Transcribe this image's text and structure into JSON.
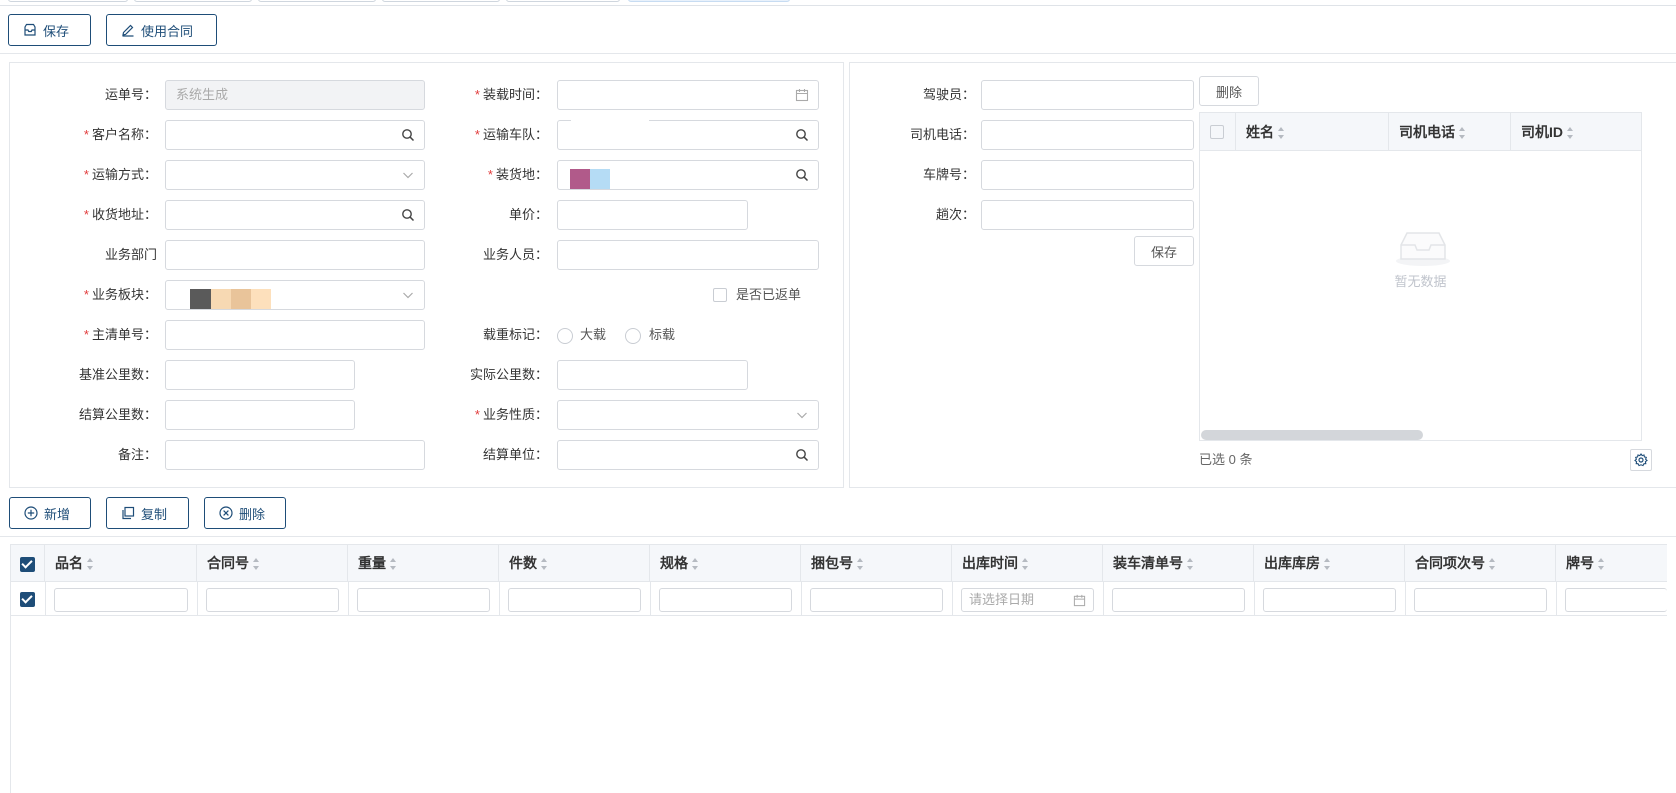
{
  "toolbar": {
    "save_label": "保存",
    "use_contract_label": "使用合同"
  },
  "form": {
    "waybill_no": {
      "label": "运单号：",
      "placeholder": "系统生成"
    },
    "customer_name": {
      "label": "客户名称："
    },
    "transport_mode": {
      "label": "运输方式："
    },
    "receive_address": {
      "label": "收货地址："
    },
    "business_dept": {
      "label": "业务部门"
    },
    "business_segment": {
      "label": "业务板块："
    },
    "master_order_no": {
      "label": "主清单号："
    },
    "base_km": {
      "label": "基准公里数："
    },
    "settle_km": {
      "label": "结算公里数："
    },
    "remark": {
      "label": "备注："
    },
    "load_time": {
      "label": "装载时间："
    },
    "transport_fleet": {
      "label": "运输车队："
    },
    "load_place": {
      "label": "装货地："
    },
    "unit_price": {
      "label": "单价："
    },
    "salesperson": {
      "label": "业务人员："
    },
    "returned": {
      "label": "是否已返单"
    },
    "load_mark": {
      "label": "载重标记：",
      "option_big": "大载",
      "option_std": "标载"
    },
    "actual_km": {
      "label": "实际公里数："
    },
    "business_nature": {
      "label": "业务性质："
    },
    "settle_unit": {
      "label": "结算单位："
    }
  },
  "driver": {
    "name_label": "驾驶员：",
    "phone_label": "司机电话：",
    "plate_label": "车牌号：",
    "trips_label": "趟次：",
    "save_label": "保存",
    "delete_label": "删除",
    "table": {
      "columns": [
        "姓名",
        "司机电话",
        "司机ID"
      ],
      "empty_text": "暂无数据"
    },
    "selected_text": "已选 0 条"
  },
  "grid_toolbar": {
    "add_label": "新增",
    "copy_label": "复制",
    "delete_label": "删除"
  },
  "grid": {
    "columns": [
      "品名",
      "合同号",
      "重量",
      "件数",
      "规格",
      "捆包号",
      "出库时间",
      "装车清单号",
      "出库库房",
      "合同项次号",
      "牌号"
    ],
    "date_placeholder": "请选择日期"
  },
  "colors": {
    "primary": "#1e4d78",
    "required": "#e23b3b"
  }
}
